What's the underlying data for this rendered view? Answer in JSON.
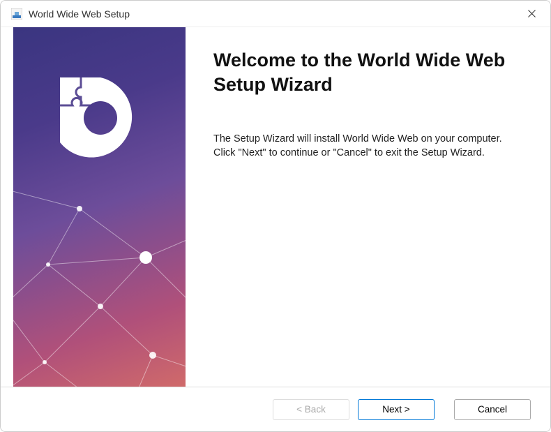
{
  "window": {
    "title": "World Wide Web Setup"
  },
  "main": {
    "heading": "Welcome to the World Wide Web Setup Wizard",
    "body": "The Setup Wizard will install World Wide Web on your computer.  Click \"Next\" to continue or \"Cancel\" to exit the Setup Wizard."
  },
  "footer": {
    "back_label": "< Back",
    "next_label": "Next >",
    "cancel_label": "Cancel",
    "back_enabled": false
  }
}
